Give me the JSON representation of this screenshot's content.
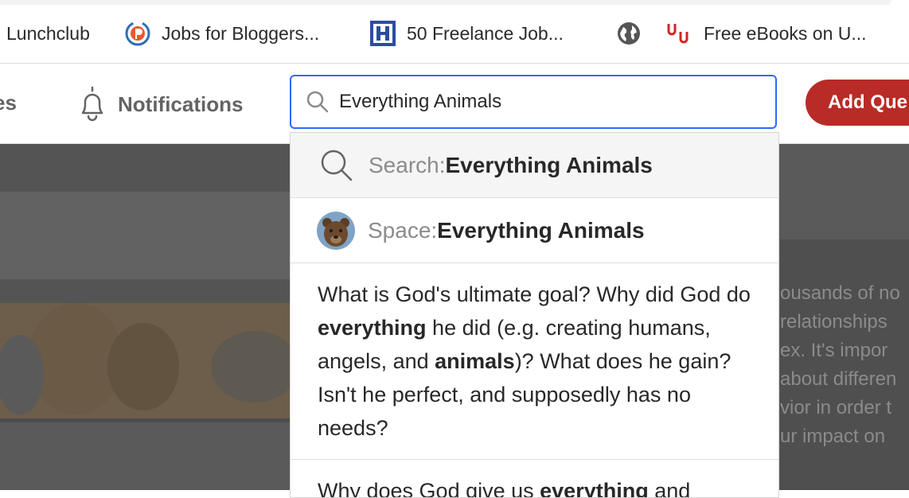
{
  "bookmarks": [
    {
      "label": "Lunchclub",
      "icon": "none"
    },
    {
      "label": "Jobs for Bloggers...",
      "icon": "pro-blogger-icon"
    },
    {
      "label": "50 Freelance Job...",
      "icon": "h-logo-icon"
    },
    {
      "label": "",
      "icon": "globe-icon"
    },
    {
      "label": "Free eBooks on U...",
      "icon": "uu-logo-icon"
    }
  ],
  "header": {
    "spaces_partial": "es",
    "notifications_label": "Notifications",
    "add_question_label": "Add Que"
  },
  "search": {
    "value": "Everything Animals"
  },
  "dropdown": {
    "search_prefix": "Search: ",
    "search_term": "Everything Animals",
    "space_prefix": "Space: ",
    "space_term": "Everything Animals",
    "q1": [
      {
        "t": "What is God's ultimate goal? Why did God do ",
        "b": false
      },
      {
        "t": "everything",
        "b": true
      },
      {
        "t": " he did (e.g. creating humans, angels, and ",
        "b": false
      },
      {
        "t": "animals",
        "b": true
      },
      {
        "t": ")? What does he gain? Isn't he perfect, and supposedly has no needs?",
        "b": false
      }
    ],
    "q2": [
      {
        "t": "Why does God give us ",
        "b": false
      },
      {
        "t": "everything",
        "b": true
      },
      {
        "t": " and",
        "b": false
      }
    ]
  },
  "background_text": [
    "ousands of no",
    "relationships",
    "ex. It's impor",
    "about differen",
    "vior in order t",
    "ur impact on"
  ],
  "colors": {
    "accent_blue": "#2e69ff",
    "brand_red": "#b92b27"
  }
}
